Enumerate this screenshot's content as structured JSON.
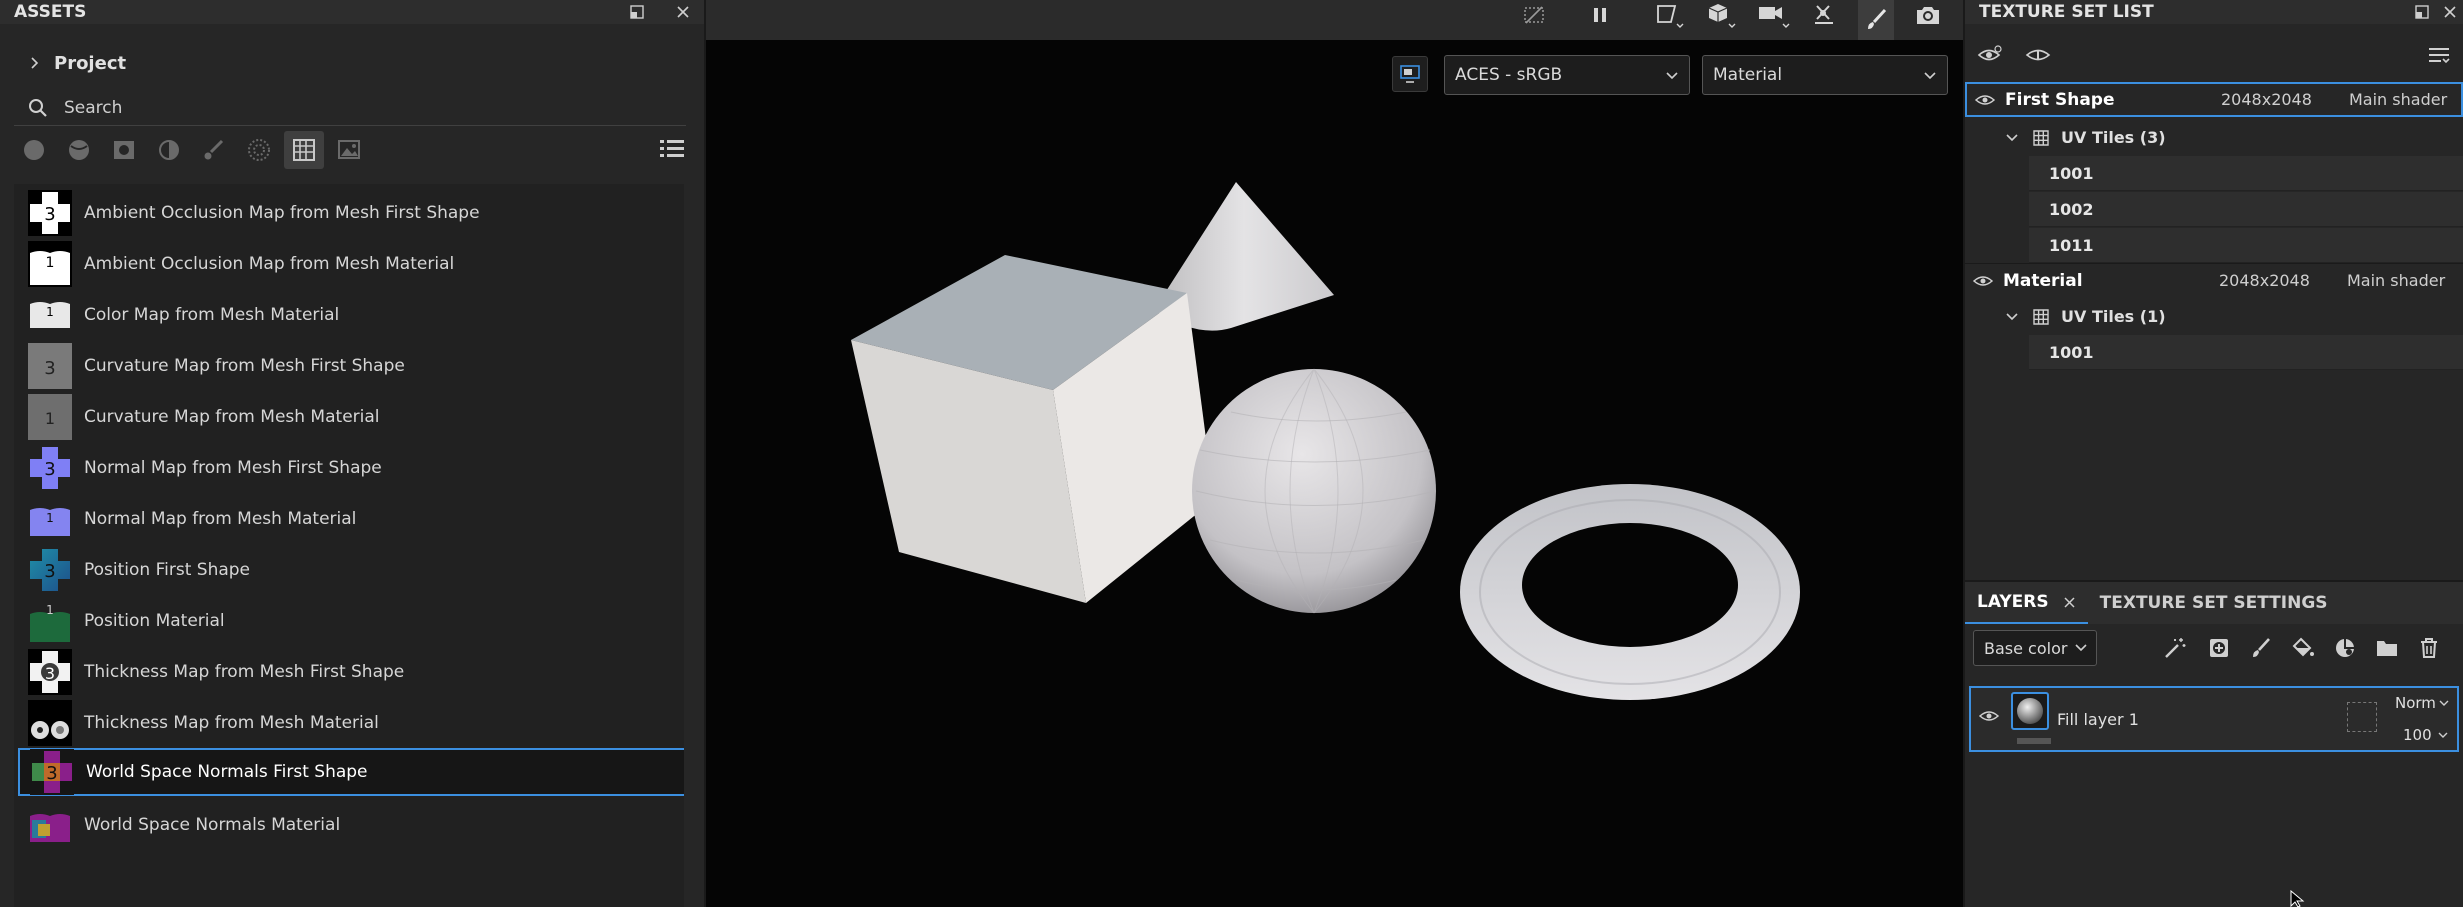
{
  "assets_panel": {
    "title": "ASSETS",
    "project_label": "Project",
    "search_placeholder": "Search",
    "filters": [
      "materials-icon",
      "smart-materials-icon",
      "smart-masks-icon",
      "filters-icon",
      "brushes-icon",
      "particles-icon",
      "textures-icon",
      "environments-icon"
    ],
    "active_filter": "textures-icon",
    "items": [
      {
        "name": "Ambient Occlusion Map from Mesh First Shape",
        "thumb": "ao3"
      },
      {
        "name": "Ambient Occlusion Map from Mesh Material",
        "thumb": "ao1"
      },
      {
        "name": "Color Map from Mesh Material",
        "thumb": "color1"
      },
      {
        "name": "Curvature Map from Mesh First Shape",
        "thumb": "curv3"
      },
      {
        "name": "Curvature Map from Mesh Material",
        "thumb": "curv1"
      },
      {
        "name": "Normal Map from Mesh First Shape",
        "thumb": "norm3"
      },
      {
        "name": "Normal Map from Mesh Material",
        "thumb": "norm1"
      },
      {
        "name": "Position First Shape",
        "thumb": "pos3"
      },
      {
        "name": "Position Material",
        "thumb": "pos1"
      },
      {
        "name": "Thickness Map from Mesh First Shape",
        "thumb": "thick3"
      },
      {
        "name": "Thickness Map from Mesh Material",
        "thumb": "thick1"
      },
      {
        "name": "World Space Normals First Shape",
        "thumb": "wsn3"
      },
      {
        "name": "World Space Normals Material",
        "thumb": "wsn1"
      }
    ],
    "selected_index": 11
  },
  "viewport": {
    "colorspace": "ACES - sRGB",
    "channel": "Material",
    "toolbar_icons": [
      "hide-icon",
      "pause-icon",
      "viewport-mode-icon",
      "object-icon",
      "camera-icon",
      "layout-icon",
      "paint-brush-icon",
      "screenshot-icon"
    ],
    "active_tool": "paint-brush-icon"
  },
  "texture_set_list": {
    "title": "TEXTURE SET LIST",
    "sets": [
      {
        "name": "First Shape",
        "resolution": "2048x2048",
        "shader": "Main shader",
        "uv_label": "UV Tiles (3)",
        "tiles": [
          "1001",
          "1002",
          "1011"
        ]
      },
      {
        "name": "Material",
        "resolution": "2048x2048",
        "shader": "Main shader",
        "uv_label": "UV Tiles (1)",
        "tiles": [
          "1001"
        ]
      }
    ]
  },
  "layers": {
    "tab_layers": "LAYERS",
    "tab_settings": "TEXTURE SET SETTINGS",
    "channel": "Base color",
    "layer": {
      "name": "Fill layer 1",
      "blend": "Norm",
      "opacity": "100"
    }
  },
  "colors": {
    "accent": "#3b8fe0",
    "panel": "#262626",
    "viewport_bg": "#050505"
  }
}
